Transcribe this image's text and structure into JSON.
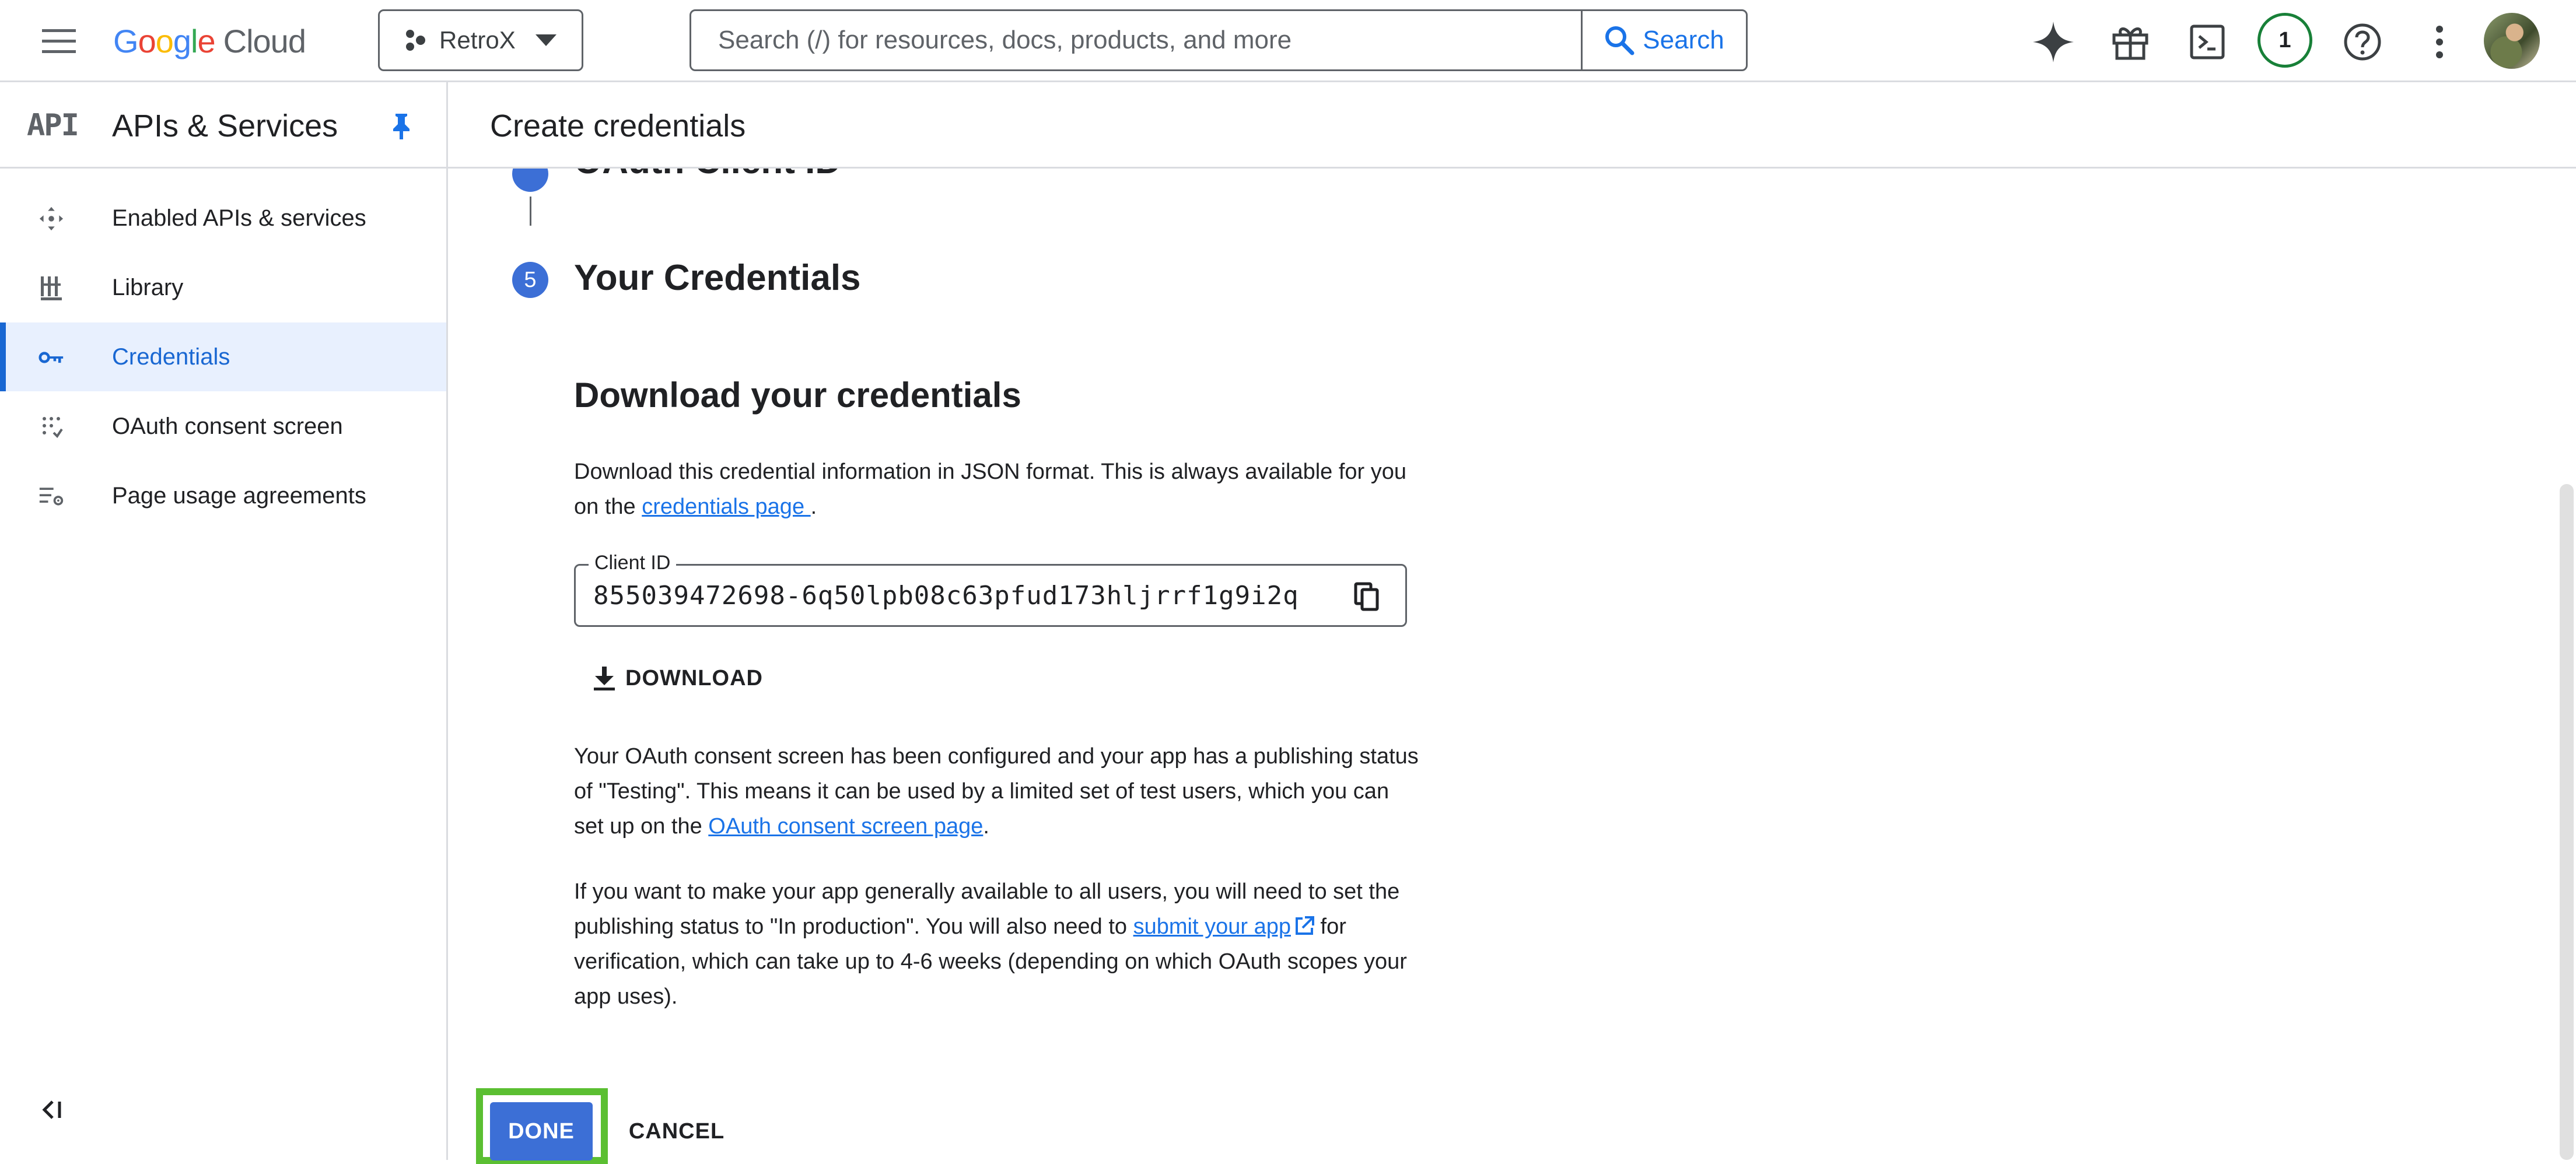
{
  "topbar": {
    "logo_letters": [
      "G",
      "o",
      "o",
      "g",
      "l",
      "e"
    ],
    "logo_product": "Cloud",
    "project_name": "RetroX",
    "search_placeholder": "Search (/) for resources, docs, products, and more",
    "search_button": "Search",
    "notification_count": "1"
  },
  "sidebar": {
    "api_badge": "API",
    "title": "APIs & Services",
    "items": [
      {
        "label": "Enabled APIs & services",
        "icon": "hub-icon",
        "active": false
      },
      {
        "label": "Library",
        "icon": "library-icon",
        "active": false
      },
      {
        "label": "Credentials",
        "icon": "key-icon",
        "active": true
      },
      {
        "label": "OAuth consent screen",
        "icon": "consent-icon",
        "active": false
      },
      {
        "label": "Page usage agreements",
        "icon": "settings-list-icon",
        "active": false
      }
    ],
    "collapse_label": "<I"
  },
  "main": {
    "page_title": "Create credentials",
    "prev_step_title": "OAuth Client ID",
    "step_number": "5",
    "step_title": "Your Credentials",
    "section_title": "Download your credentials",
    "para1_text": "Download this credential information in JSON format. This is always available for you on the ",
    "para1_link": "credentials page ",
    "para1_end": ".",
    "client_id_label": "Client ID",
    "client_id_value": "855039472698-6q50lpb08c63pfud173hljrrf1g9i2q",
    "download_label": "DOWNLOAD",
    "para2_text": "Your OAuth consent screen has been configured and your app has a publishing status of \"Testing\". This means it can be used by a limited set of test users, which you can set up on the ",
    "para2_link": "OAuth consent screen page",
    "para2_end": ".",
    "para3_text": "If you want to make your app generally available to all users, you will need to set the publishing status to \"In production\". You will also need to ",
    "para3_link": "submit your app",
    "para3_end": " for verification, which can take up to 4-6 weeks (depending on which OAuth scopes your app uses).",
    "done_label": "DONE",
    "cancel_label": "CANCEL"
  },
  "colors": {
    "accent": "#1a73e8",
    "primary_button": "#3c6fd6",
    "active_nav_bg": "#e8f0fe",
    "highlight": "#5bbf32",
    "badge_ring": "#188038"
  }
}
